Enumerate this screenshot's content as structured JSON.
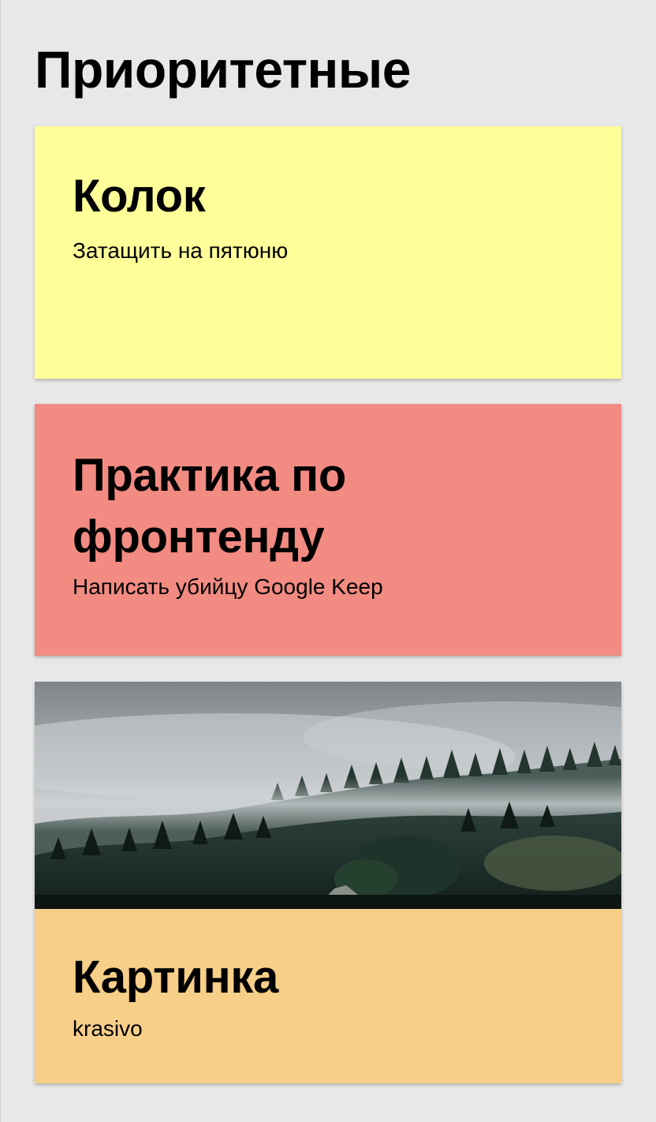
{
  "page": {
    "title": "Приоритетные"
  },
  "notes": [
    {
      "title": "Колок",
      "text": "Затащить на пятюню",
      "color": "#ffff99"
    },
    {
      "title": "Практика по фронтенду",
      "text": "Написать убийцу Google Keep",
      "color": "#f28b82"
    },
    {
      "title": "Картинка",
      "text": "krasivo",
      "color": "#f7cf88",
      "image": "foggy-forest-landscape"
    }
  ]
}
